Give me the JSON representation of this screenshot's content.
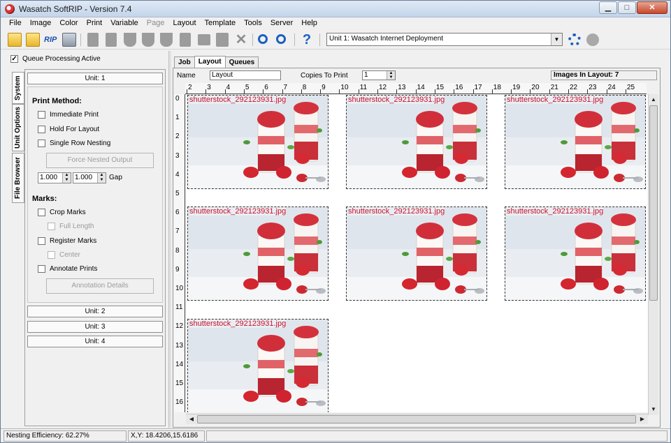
{
  "window": {
    "title": "Wasatch SoftRIP - Version 7.4"
  },
  "menu": [
    {
      "label": "File",
      "disabled": false
    },
    {
      "label": "Image",
      "disabled": false
    },
    {
      "label": "Color",
      "disabled": false
    },
    {
      "label": "Print",
      "disabled": false
    },
    {
      "label": "Variable",
      "disabled": false
    },
    {
      "label": "Page",
      "disabled": true
    },
    {
      "label": "Layout",
      "disabled": false
    },
    {
      "label": "Template",
      "disabled": false
    },
    {
      "label": "Tools",
      "disabled": false
    },
    {
      "label": "Server",
      "disabled": false
    },
    {
      "label": "Help",
      "disabled": false
    }
  ],
  "toolbar": {
    "rip_label": "RIP",
    "unit_select": "Unit 1: Wasatch  Internet Deployment",
    "help_glyph": "?"
  },
  "left": {
    "queue_label": "Queue Processing Active",
    "queue_checked": true,
    "vtabs": [
      "System",
      "Unit Options",
      "File Browser"
    ],
    "unit1": "Unit: 1",
    "print_method_label": "Print Method:",
    "immediate_print": "Immediate Print",
    "hold_for_layout": "Hold For Layout",
    "single_row_nesting": "Single Row Nesting",
    "force_nested_output": "Force Nested Output",
    "gap_value_1": "1.000",
    "gap_value_2": "1.000",
    "gap_label": "Gap",
    "marks_label": "Marks:",
    "crop_marks": "Crop Marks",
    "full_length": "Full Length",
    "register_marks": "Register Marks",
    "center": "Center",
    "annotate_prints": "Annotate Prints",
    "annotation_details": "Annotation Details",
    "unit2": "Unit: 2",
    "unit3": "Unit: 3",
    "unit4": "Unit: 4"
  },
  "tabs": [
    "Job",
    "Layout",
    "Queues"
  ],
  "layout": {
    "name_label": "Name",
    "name_value": "Layout",
    "copies_label": "Copies To Print",
    "copies_value": "1",
    "images_in_layout": "Images In Layout: 7",
    "ruler_h": [
      "2",
      "3",
      "4",
      "5",
      "6",
      "7",
      "8",
      "9",
      "10",
      "11",
      "12",
      "13",
      "14",
      "15",
      "16",
      "17",
      "18",
      "19",
      "20",
      "21",
      "22",
      "23",
      "24",
      "25"
    ],
    "ruler_v": [
      "0",
      "1",
      "2",
      "3",
      "4",
      "5",
      "6",
      "7",
      "8",
      "9",
      "10",
      "11",
      "12",
      "13",
      "14",
      "15",
      "16"
    ],
    "images": [
      {
        "filename": "shutterstock_292123931.jpg"
      },
      {
        "filename": "shutterstock_292123931.jpg"
      },
      {
        "filename": "shutterstock_292123931.jpg"
      },
      {
        "filename": "shutterstock_292123931.jpg"
      },
      {
        "filename": "shutterstock_292123931.jpg"
      },
      {
        "filename": "shutterstock_292123931.jpg"
      },
      {
        "filename": "shutterstock_292123931.jpg"
      }
    ]
  },
  "status": {
    "nesting_efficiency": "Nesting Efficiency: 62.27%",
    "xy": "X,Y: 18.4206,15.6186"
  },
  "colors": {
    "filename_label": "#c8102e",
    "accent_blue": "#1d5fbf"
  }
}
